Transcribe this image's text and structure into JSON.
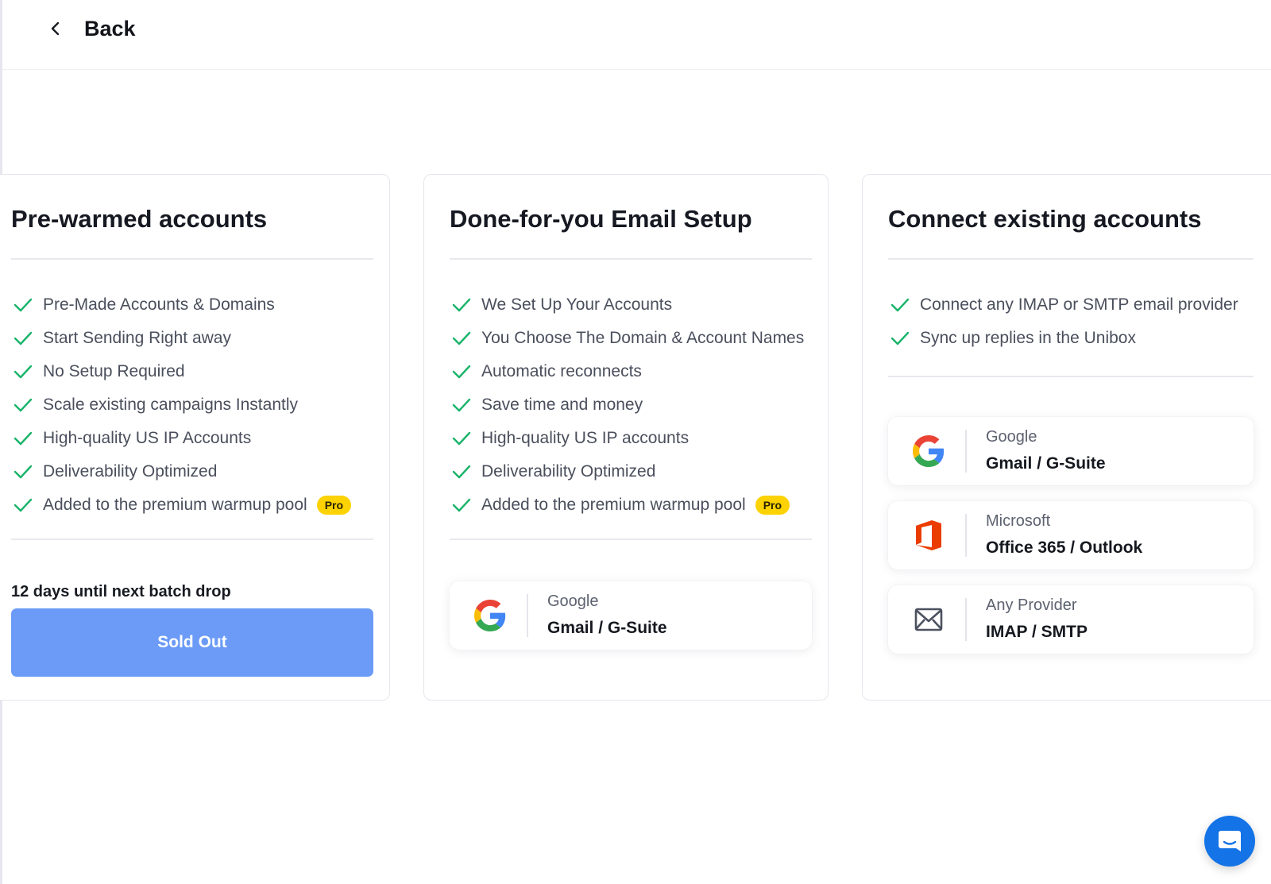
{
  "header": {
    "back_label": "Back"
  },
  "cards": {
    "prewarmed": {
      "title": "Pre-warmed accounts",
      "features": [
        "Pre-Made Accounts & Domains",
        "Start Sending Right away",
        "No Setup Required",
        "Scale existing campaigns Instantly",
        "High-quality US IP Accounts",
        "Deliverability Optimized",
        "Added to the premium warmup pool"
      ],
      "pro_badge": "Pro",
      "countdown": "12 days until next batch drop",
      "button_label": "Sold Out"
    },
    "dfy": {
      "title": "Done-for-you Email Setup",
      "features": [
        "We Set Up Your Accounts",
        "You Choose The Domain & Account Names",
        "Automatic reconnects",
        "Save time and money",
        "High-quality US IP accounts",
        "Deliverability Optimized",
        "Added to the premium warmup pool"
      ],
      "pro_badge": "Pro",
      "providers": [
        {
          "name": "Google",
          "desc": "Gmail / G-Suite",
          "icon": "google-icon"
        }
      ]
    },
    "connect": {
      "title": "Connect existing accounts",
      "features": [
        "Connect any IMAP or SMTP email provider",
        "Sync up replies in the Unibox"
      ],
      "providers": [
        {
          "name": "Google",
          "desc": "Gmail / G-Suite",
          "icon": "google-icon"
        },
        {
          "name": "Microsoft",
          "desc": "Office 365 / Outlook",
          "icon": "office-icon"
        },
        {
          "name": "Any Provider",
          "desc": "IMAP / SMTP",
          "icon": "mail-icon"
        }
      ]
    }
  },
  "colors": {
    "check": "#19b46a",
    "pro_badge": "#fcd200",
    "sold_out_button": "#6b9bf7",
    "chat_button": "#1473e6"
  },
  "chat": {
    "icon": "chat-icon"
  }
}
